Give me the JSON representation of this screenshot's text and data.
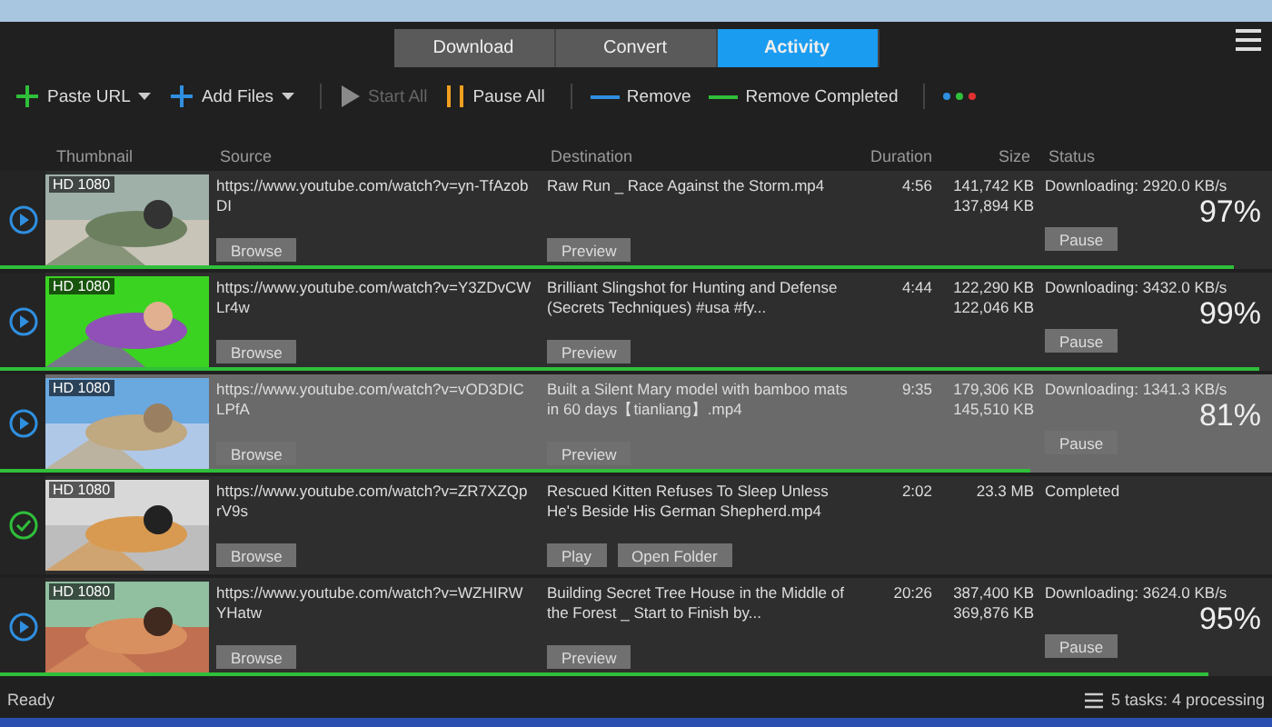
{
  "tabs": [
    {
      "label": "Download",
      "selected": false
    },
    {
      "label": "Convert",
      "selected": false
    },
    {
      "label": "Activity",
      "selected": true
    }
  ],
  "toolbar": [
    {
      "kind": "plus",
      "label": "Paste URL",
      "color": "#2fbf3a",
      "dropdown": true,
      "disabled": false
    },
    {
      "kind": "plus",
      "label": "Add Files",
      "color": "#2f8fe0",
      "dropdown": true,
      "disabled": false
    },
    {
      "kind": "play",
      "label": "Start All",
      "color": "#8a8a8a",
      "dropdown": false,
      "disabled": true
    },
    {
      "kind": "pause",
      "label": "Pause All",
      "color": "#f0a020",
      "dropdown": false,
      "disabled": false
    },
    {
      "kind": "line",
      "label": "Remove",
      "color": "#2f8fe0",
      "dropdown": false,
      "disabled": false
    },
    {
      "kind": "line",
      "label": "Remove Completed",
      "color": "#2fbf3a",
      "dropdown": false,
      "disabled": false
    }
  ],
  "columns": [
    "Thumbnail",
    "Source",
    "Destination",
    "Duration",
    "Size",
    "Status"
  ],
  "rows": [
    {
      "kind": "downloading",
      "selected": false,
      "badge": "HD 1080",
      "source": "https://www.youtube.com/watch?v=yn-TfAzobDI",
      "browse": "Browse",
      "destination": "Raw Run _ Race Against the Storm.mp4",
      "buttons": [
        "Preview"
      ],
      "duration": "4:56",
      "size": [
        "141,742 KB",
        "137,894 KB"
      ],
      "status": "Downloading: 2920.0 KB/s",
      "percent": "97%",
      "action": "Pause",
      "level": 0.97
    },
    {
      "kind": "downloading",
      "selected": false,
      "badge": "HD 1080",
      "source": "https://www.youtube.com/watch?v=Y3ZDvCWLr4w",
      "browse": "Browse",
      "destination": "Brilliant Slingshot for Hunting and Defense (Secrets Techniques) #usa #fy...",
      "buttons": [
        "Preview"
      ],
      "duration": "4:44",
      "size": [
        "122,290 KB",
        "122,046 KB"
      ],
      "status": "Downloading: 3432.0 KB/s",
      "percent": "99%",
      "action": "Pause",
      "level": 0.99
    },
    {
      "kind": "downloading",
      "selected": true,
      "badge": "HD 1080",
      "source": "https://www.youtube.com/watch?v=vOD3DICLPfA",
      "browse": "Browse",
      "destination": "Built a Silent Mary model with bamboo mats in 60 days【tianliang】.mp4",
      "buttons": [
        "Preview"
      ],
      "duration": "9:35",
      "size": [
        "179,306 KB",
        "145,510 KB"
      ],
      "status": "Downloading: 1341.3 KB/s",
      "percent": "81%",
      "action": "Pause",
      "level": 0.81
    },
    {
      "kind": "completed",
      "selected": false,
      "badge": "HD 1080",
      "source": "https://www.youtube.com/watch?v=ZR7XZQprV9s",
      "browse": "Browse",
      "destination": "Rescued Kitten Refuses To Sleep Unless He's Beside His German Shepherd.mp4",
      "buttons": [
        "Play",
        "Open Folder"
      ],
      "duration": "2:02",
      "size": [
        "23.3 MB"
      ],
      "status": "Completed"
    },
    {
      "kind": "downloading",
      "selected": false,
      "badge": "HD 1080",
      "source": "https://www.youtube.com/watch?v=WZHIRWYHatw",
      "browse": "Browse",
      "destination": "Building Secret Tree House in the Middle of the Forest _ Start to Finish by...",
      "buttons": [
        "Preview"
      ],
      "duration": "20:26",
      "size": [
        "387,400 KB",
        "369,876 KB"
      ],
      "status": "Downloading: 3624.0 KB/s",
      "percent": "95%",
      "action": "Pause",
      "level": 0.95
    }
  ],
  "status_bar": {
    "left": "Ready",
    "right": "5 tasks: 4 processing"
  }
}
